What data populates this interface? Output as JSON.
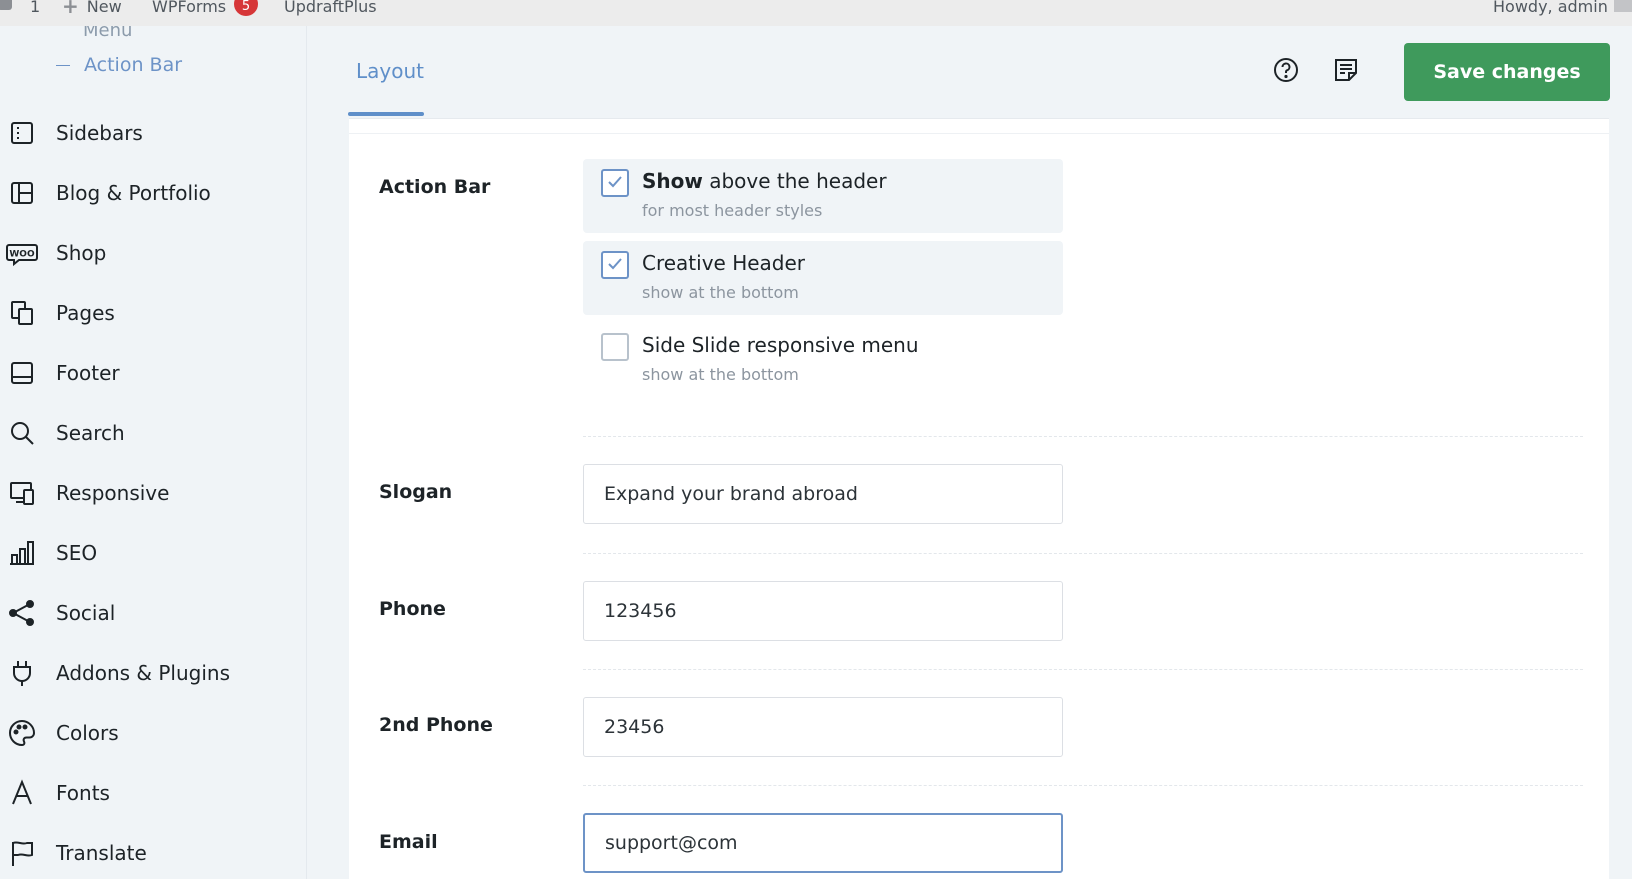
{
  "admin_bar": {
    "comment_count": "1",
    "new_label": "New",
    "wpforms_label": "WPForms",
    "wpforms_badge": "5",
    "updraft_label": "UpdraftPlus",
    "howdy": "Howdy, admin"
  },
  "sidebar": {
    "menu_cut_label": "Menu",
    "active_sub_item": "Action Bar",
    "items": [
      {
        "label": "Sidebars",
        "icon": "sidebars-icon"
      },
      {
        "label": "Blog & Portfolio",
        "icon": "layout-grid-icon"
      },
      {
        "label": "Shop",
        "icon": "woo-icon"
      },
      {
        "label": "Pages",
        "icon": "pages-icon"
      },
      {
        "label": "Footer",
        "icon": "footer-icon"
      },
      {
        "label": "Search",
        "icon": "search-icon"
      },
      {
        "label": "Responsive",
        "icon": "responsive-icon"
      },
      {
        "label": "SEO",
        "icon": "bar-chart-icon"
      },
      {
        "label": "Social",
        "icon": "share-icon"
      },
      {
        "label": "Addons & Plugins",
        "icon": "plug-icon"
      },
      {
        "label": "Colors",
        "icon": "palette-icon"
      },
      {
        "label": "Fonts",
        "icon": "font-icon"
      },
      {
        "label": "Translate",
        "icon": "flag-icon"
      }
    ]
  },
  "header": {
    "tab_layout": "Layout",
    "save_label": "Save changes"
  },
  "form": {
    "action_bar": {
      "label": "Action Bar",
      "options": [
        {
          "title_bold": "Show",
          "title_rest": " above the header",
          "subtitle": "for most header styles",
          "checked": true
        },
        {
          "title_bold": "",
          "title_rest": "Creative Header",
          "subtitle": "show at the bottom",
          "checked": true
        },
        {
          "title_bold": "",
          "title_rest": "Side Slide responsive menu",
          "subtitle": "show at the bottom",
          "checked": false
        }
      ]
    },
    "slogan": {
      "label": "Slogan",
      "value": "Expand your brand abroad"
    },
    "phone": {
      "label": "Phone",
      "value": "123456"
    },
    "phone2": {
      "label": "2nd Phone",
      "value": "23456"
    },
    "email": {
      "label": "Email",
      "value": "support@com"
    }
  },
  "colors": {
    "accent": "#5f8fc9",
    "save_button": "#3f9a5c",
    "badge": "#d63638"
  }
}
